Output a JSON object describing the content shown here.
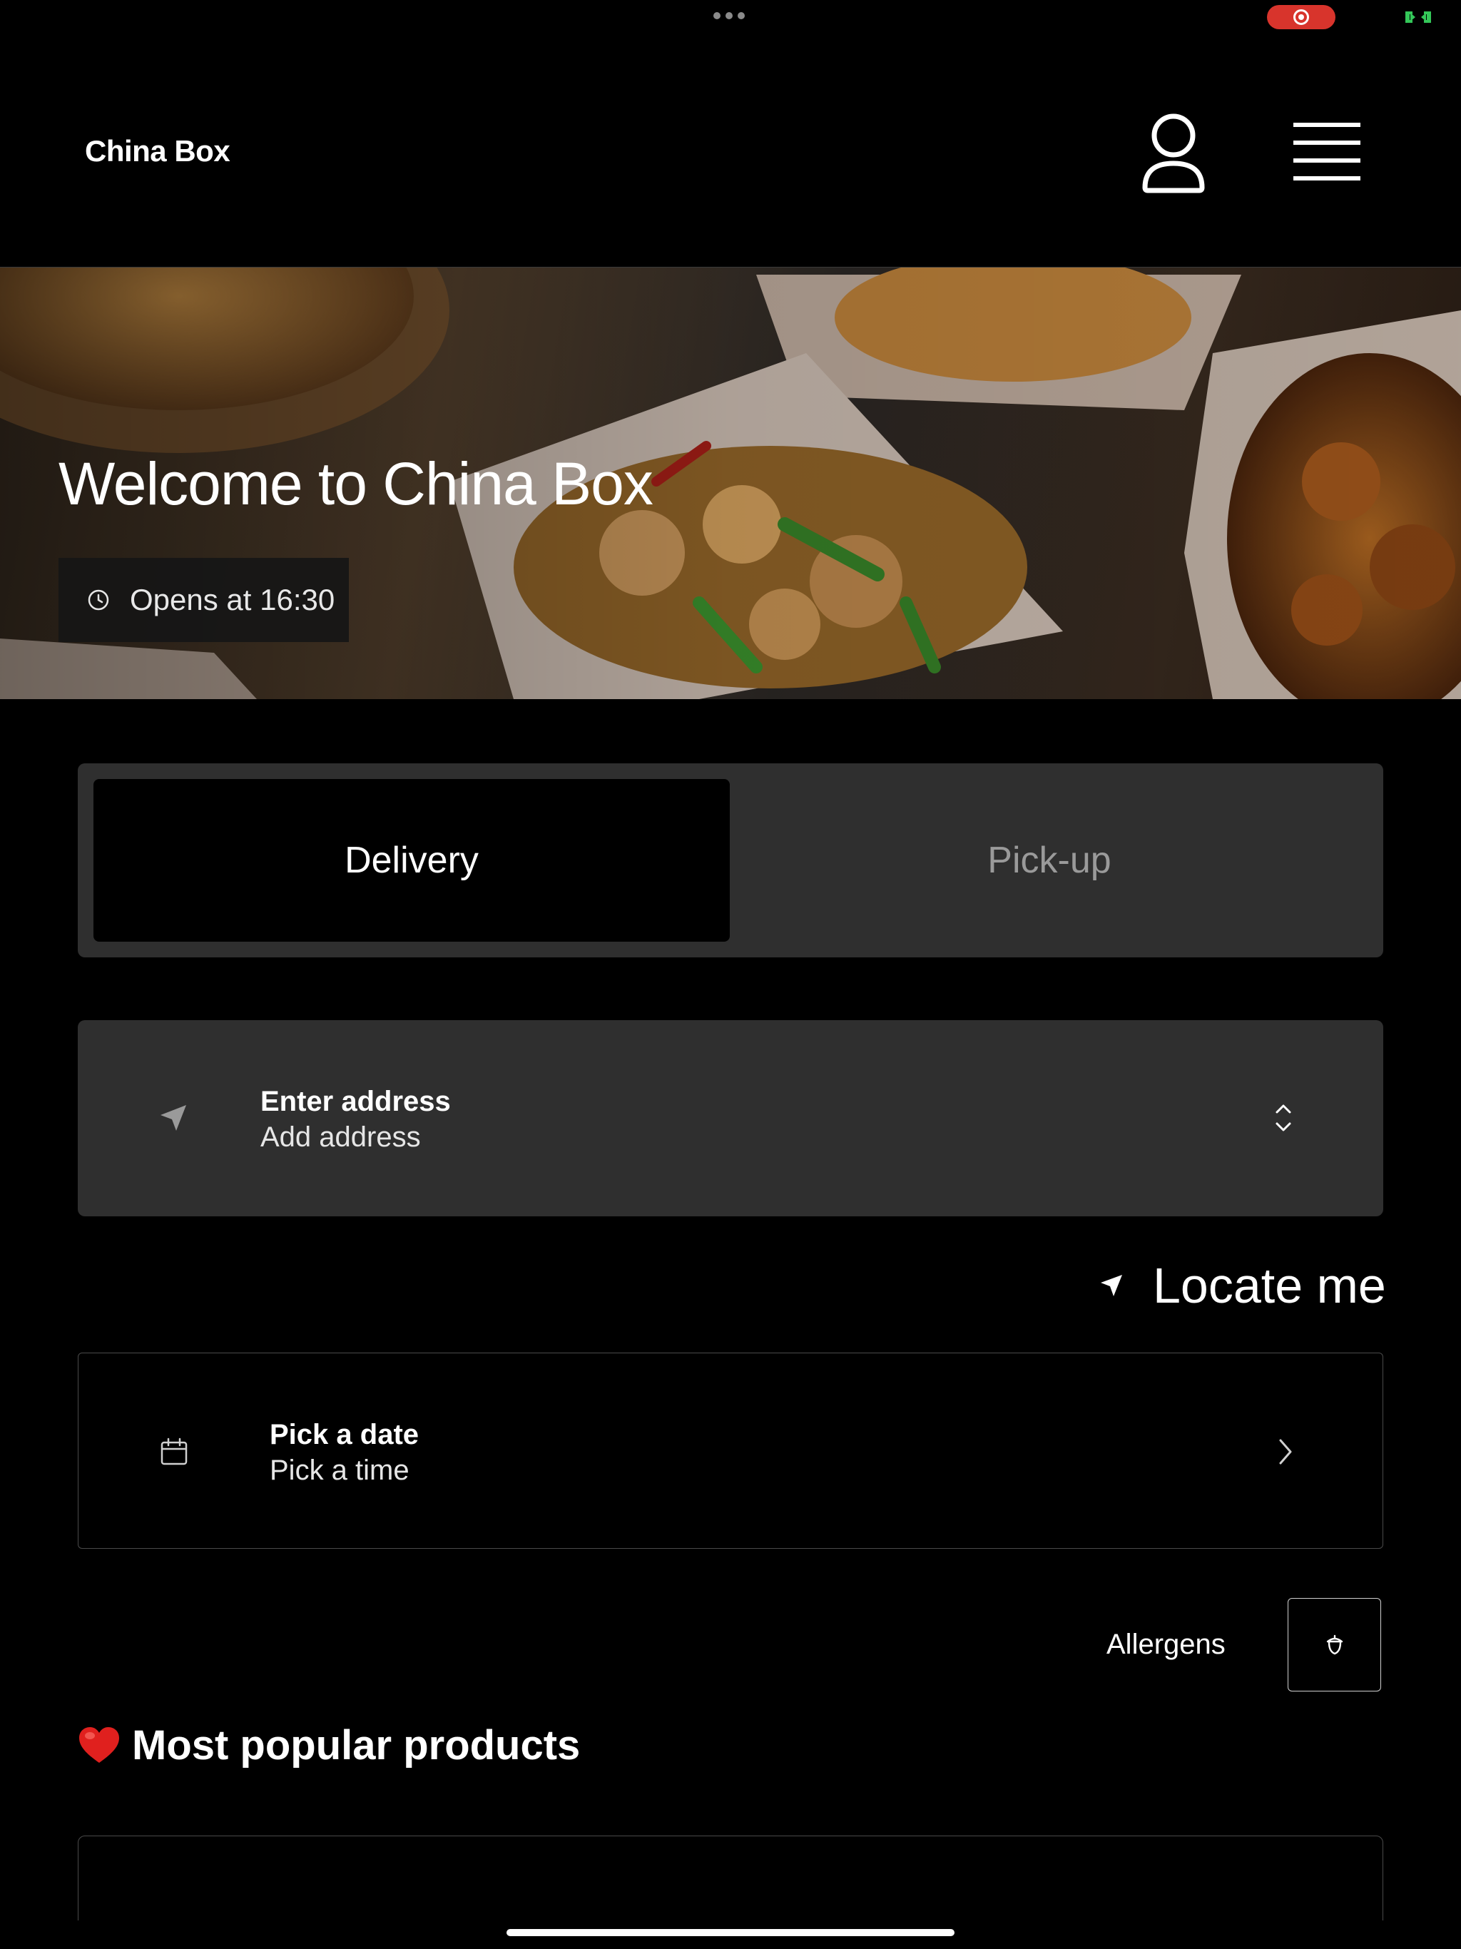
{
  "status_bar": {
    "dots_icon": "more-dots-icon",
    "recording_icon": "screen-recording-icon",
    "battery_icon": "battery-icon",
    "recording_color": "#d8342c",
    "battery_color": "#34c759"
  },
  "header": {
    "brand": "China Box",
    "profile_icon": "user-icon",
    "menu_icon": "hamburger-menu-icon"
  },
  "hero": {
    "title": "Welcome to China Box",
    "hours_icon": "clock-icon",
    "hours": "Opens at 16:30"
  },
  "mode_toggle": {
    "options": [
      "Delivery",
      "Pick-up"
    ],
    "selected": "Delivery"
  },
  "address": {
    "icon": "navigation-arrow-icon",
    "title": "Enter address",
    "subtitle": "Add address",
    "chevron": "chevron-up-down-icon"
  },
  "locate": {
    "icon": "location-arrow-icon",
    "label": "Locate me"
  },
  "schedule": {
    "icon": "calendar-icon",
    "title": "Pick a date",
    "subtitle": "Pick a time",
    "chevron": "chevron-right-icon"
  },
  "allergens": {
    "label": "Allergens",
    "icon": "acorn-icon"
  },
  "popular": {
    "icon": "heart-emoji-icon",
    "title": "Most popular products",
    "heart_color": "#e0201e"
  }
}
